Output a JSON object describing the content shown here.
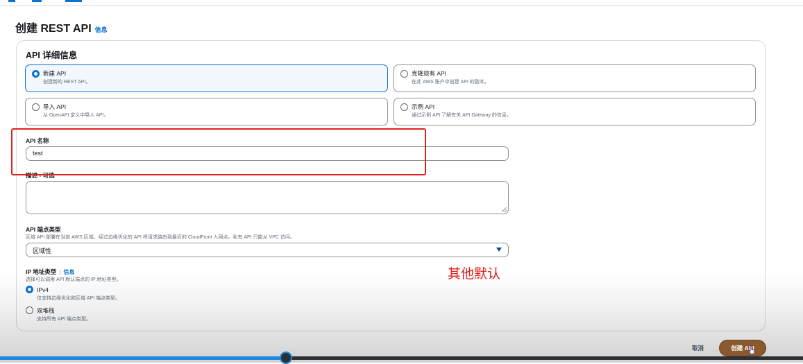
{
  "page": {
    "title": "创建 REST API",
    "info_link": "信息"
  },
  "panel": {
    "title": "API 详细信息"
  },
  "api_options": [
    {
      "label": "新建 API",
      "desc": "创建新的 REST API。",
      "selected": true
    },
    {
      "label": "克隆现有 API",
      "desc": "在此 AWS 账户中创建 API 的副本。",
      "selected": false
    },
    {
      "label": "导入 API",
      "desc": "从 OpenAPI 定义中导入 API。",
      "selected": false
    },
    {
      "label": "示例 API",
      "desc": "通过示例 API 了解有关 API Gateway 的信息。",
      "selected": false
    }
  ],
  "api_name": {
    "label": "API 名称",
    "value": "test"
  },
  "description": {
    "label": "描述 - 可选",
    "value": ""
  },
  "endpoint_type": {
    "label": "API 端点类型",
    "desc": "区域 API 部署在当前 AWS 区域。经过边缘优化的 API 将请求路由到最近的 CloudFront 入网点。私有 API 只能从 VPC 访问。",
    "selected": "区域性"
  },
  "ip_type": {
    "label": "IP 地址类型",
    "info_link": "信息",
    "desc": "选择可以调用 API 默认端点的 IP 地址类型。",
    "options": [
      {
        "label": "IPv4",
        "desc": "仅支持边缘优化和区域 API 端点类型。",
        "selected": true
      },
      {
        "label": "双堆栈",
        "desc": "支持所有 API 端点类型。",
        "selected": false
      }
    ]
  },
  "annotation": "其他默认",
  "footer": {
    "cancel_label": "取消",
    "create_label": "创建 API"
  },
  "video_progress": 0.356,
  "colors": {
    "accent": "#0972d3",
    "annotation_red": "#e0201c",
    "create_button": "#8a5a2e"
  }
}
